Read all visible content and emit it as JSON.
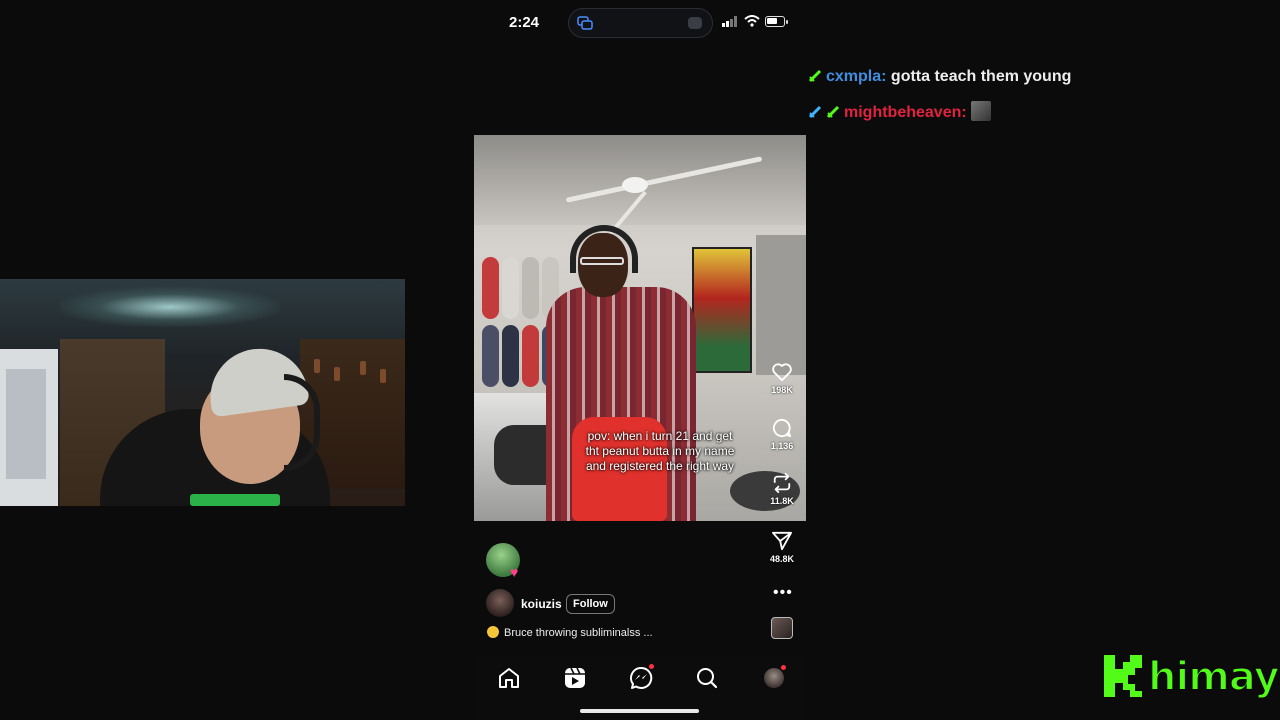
{
  "status_bar": {
    "time": "2:24"
  },
  "video": {
    "caption": "pov: when i turn 21 and get tht peanut butta in my name and registered the right way"
  },
  "actions": {
    "likes": "198K",
    "comments": "1,136",
    "reposts": "11.8K",
    "shares": "48.8K"
  },
  "creator": {
    "username": "koiuzis",
    "follow_label": "Follow",
    "caption": "Bruce throwing subliminalss ..."
  },
  "nav": {
    "items": [
      "home-icon",
      "reels-icon",
      "messenger-icon",
      "search-icon",
      "profile-avatar"
    ]
  },
  "chat": [
    {
      "user": "cxmpla:",
      "message": "gotta teach them young",
      "user_color": "#3f8ee0"
    },
    {
      "user": "mightbeheaven:",
      "message": "",
      "user_color": "#e0243f"
    }
  ],
  "watermark": {
    "letter": "K",
    "text": "himay",
    "color": "#53fc18"
  }
}
